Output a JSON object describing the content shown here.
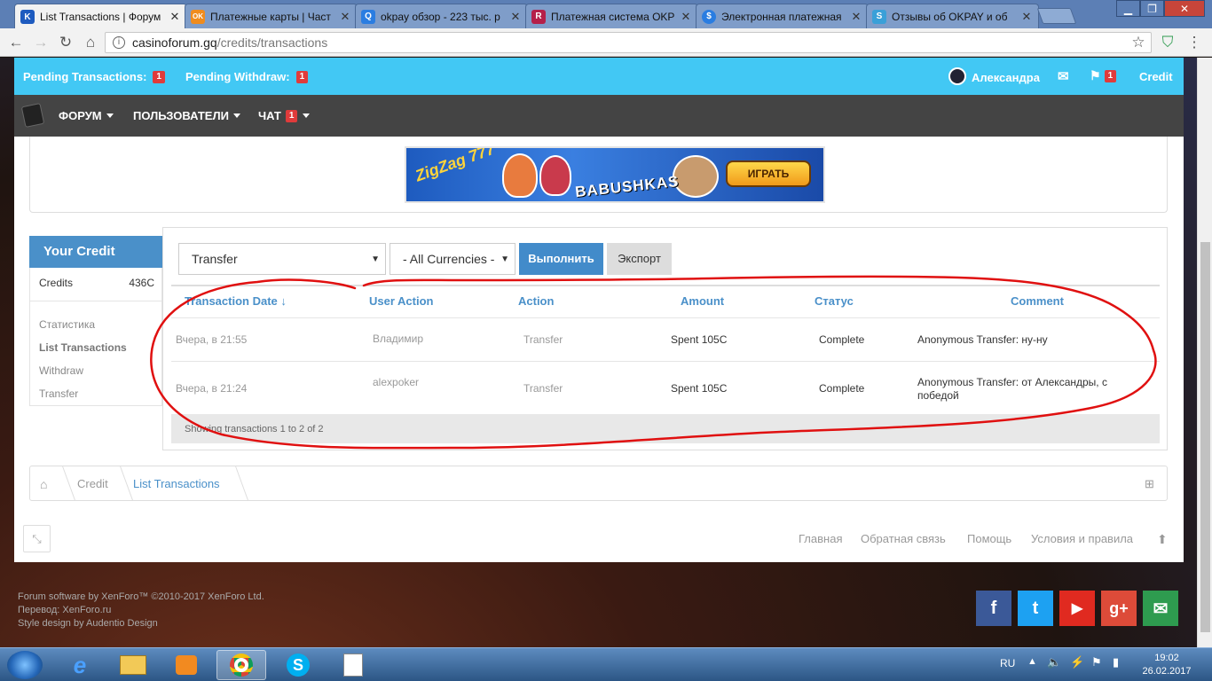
{
  "browser": {
    "tabs": [
      {
        "title": "List Transactions | Форум",
        "icon_color": "#1e5bbf",
        "icon_text": "K",
        "active": true
      },
      {
        "title": "Платежные карты | Част",
        "icon_color": "#f08c1e",
        "icon_text": "OK",
        "active": false
      },
      {
        "title": "okpay обзор - 223 тыс. р",
        "icon_color": "#2a7de1",
        "icon_text": "Q",
        "active": false
      },
      {
        "title": "Платежная система OKP",
        "icon_color": "#b5204a",
        "icon_text": "R",
        "active": false
      },
      {
        "title": "Электронная платежная",
        "icon_color": "#2a7de1",
        "icon_text": "$",
        "active": false
      },
      {
        "title": "Отзывы об OKPAY и об",
        "icon_color": "#3aa0d8",
        "icon_text": "S",
        "active": false
      }
    ],
    "url_domain": "casinoforum.gq",
    "url_path": "/credits/transactions"
  },
  "topbar": {
    "pending_transactions_label": "Pending Transactions:",
    "pending_transactions_count": "1",
    "pending_withdraw_label": "Pending Withdraw:",
    "pending_withdraw_count": "1",
    "username": "Александра",
    "alerts_count": "1",
    "credit_label": "Credit"
  },
  "nav": {
    "forum": "ФОРУМ",
    "users": "ПОЛЬЗОВАТЕЛИ",
    "chat": "ЧАТ",
    "chat_count": "1"
  },
  "banner": {
    "brand": "ZigZag 777",
    "game": "BABUSHKAS",
    "cta": "ИГРАТЬ"
  },
  "sidebar": {
    "title": "Your Credit",
    "credits_label": "Credits",
    "credits_value": "436C",
    "items": [
      "Статистика",
      "List Transactions",
      "Withdraw",
      "Transfer"
    ]
  },
  "filters": {
    "type_selected": "Transfer",
    "currency_selected": "- All Currencies -",
    "run_button": "Выполнить",
    "export_button": "Экспорт"
  },
  "table": {
    "headers": [
      "Transaction Date ↓",
      "User Action",
      "Action",
      "Amount",
      "Статус",
      "Comment"
    ],
    "rows": [
      {
        "date": "Вчера, в 21:55",
        "user": "Владимир",
        "action": "Transfer",
        "amount": "Spent 105C",
        "status": "Complete",
        "comment": "Anonymous Transfer: ну-ну"
      },
      {
        "date": "Вчера, в 21:24",
        "user": "alexpoker",
        "action": "Transfer",
        "amount": "Spent 105C",
        "status": "Complete",
        "comment": "Anonymous Transfer: от Александры, с победой"
      }
    ],
    "footer": "Showing transactions 1 to 2 of 2"
  },
  "breadcrumb": [
    "Credit",
    "List Transactions"
  ],
  "footer": {
    "links": [
      "Главная",
      "Обратная связь",
      "Помощь",
      "Условия и правила"
    ],
    "copyright_lines": [
      "Forum software by XenForo™ ©2010-2017 XenForo Ltd.",
      "Перевод: XenForo.ru",
      "Style design by Audentio Design"
    ]
  },
  "social": [
    {
      "name": "facebook",
      "glyph": "f",
      "color": "#3b5998"
    },
    {
      "name": "twitter",
      "glyph": "t",
      "color": "#1da1f2"
    },
    {
      "name": "youtube",
      "glyph": "▶",
      "color": "#e02a20"
    },
    {
      "name": "google-plus",
      "glyph": "g+",
      "color": "#dd4b39"
    },
    {
      "name": "email",
      "glyph": "✉",
      "color": "#2e9b4f"
    }
  ],
  "taskbar": {
    "lang": "RU",
    "time": "19:02",
    "date": "26.02.2017"
  },
  "colors": {
    "accent_blue": "#42c8f4",
    "link_blue": "#4a90c9",
    "badge_red": "#e03b3b",
    "annotation_red": "#e01010"
  }
}
